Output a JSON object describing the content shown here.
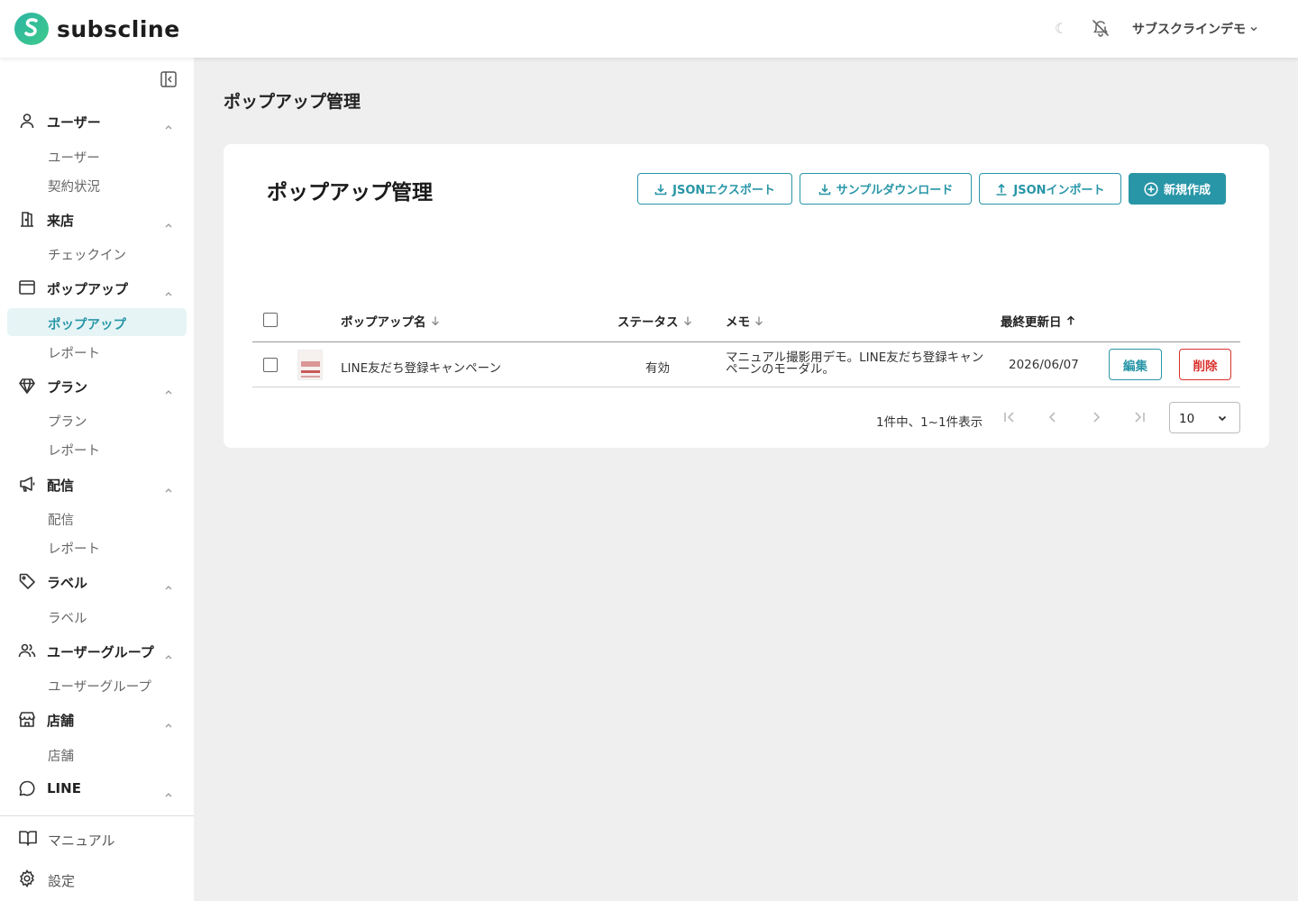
{
  "header": {
    "brand": "subscline",
    "theme_toggle_icon": "moon-icon",
    "notification_icon": "bell-off-icon",
    "account_name": "サブスクラインデモ"
  },
  "sidebar": {
    "groups": [
      {
        "label": "ユーザー",
        "icon": "user-icon",
        "items": [
          "ユーザー",
          "契約状況"
        ]
      },
      {
        "label": "来店",
        "icon": "door-icon",
        "items": [
          "チェックイン"
        ]
      },
      {
        "label": "ポップアップ",
        "icon": "window-icon",
        "items": [
          "ポップアップ",
          "レポート"
        ],
        "active_item": "ポップアップ"
      },
      {
        "label": "プラン",
        "icon": "diamond-icon",
        "items": [
          "プラン",
          "レポート"
        ]
      },
      {
        "label": "配信",
        "icon": "megaphone-icon",
        "items": [
          "配信",
          "レポート"
        ]
      },
      {
        "label": "ラベル",
        "icon": "tag-icon",
        "items": [
          "ラベル"
        ]
      },
      {
        "label": "ユーザーグループ",
        "icon": "users-icon",
        "items": [
          "ユーザーグループ"
        ]
      },
      {
        "label": "店舗",
        "icon": "store-icon",
        "items": [
          "店舗"
        ]
      },
      {
        "label": "LINE",
        "icon": "chat-bubble-icon",
        "items": []
      }
    ],
    "footer": [
      {
        "label": "マニュアル",
        "icon": "book-icon"
      },
      {
        "label": "設定",
        "icon": "gear-icon"
      }
    ]
  },
  "main": {
    "page_title": "ポップアップ管理",
    "card_title": "ポップアップ管理",
    "actions": {
      "export": "JSONエクスポート",
      "sample": "サンプルダウンロード",
      "import": "JSONインポート",
      "create": "新規作成"
    },
    "table": {
      "columns": {
        "name": "ポップアップ名",
        "status": "ステータス",
        "memo": "メモ",
        "updated": "最終更新日"
      },
      "rows": [
        {
          "name": "LINE友だち登録キャンペーン",
          "status": "有効",
          "memo": "マニュアル撮影用デモ。LINE友だち登録キャンペーンのモーダル。",
          "updated": "2026/06/07",
          "edit": "編集",
          "delete": "削除"
        }
      ]
    },
    "pagination": {
      "summary": "1件中、1~1件表示",
      "per_page": "10"
    }
  },
  "colors": {
    "accent": "#2896a7",
    "danger": "#d9302c",
    "active_bg": "#e6f4f6"
  }
}
